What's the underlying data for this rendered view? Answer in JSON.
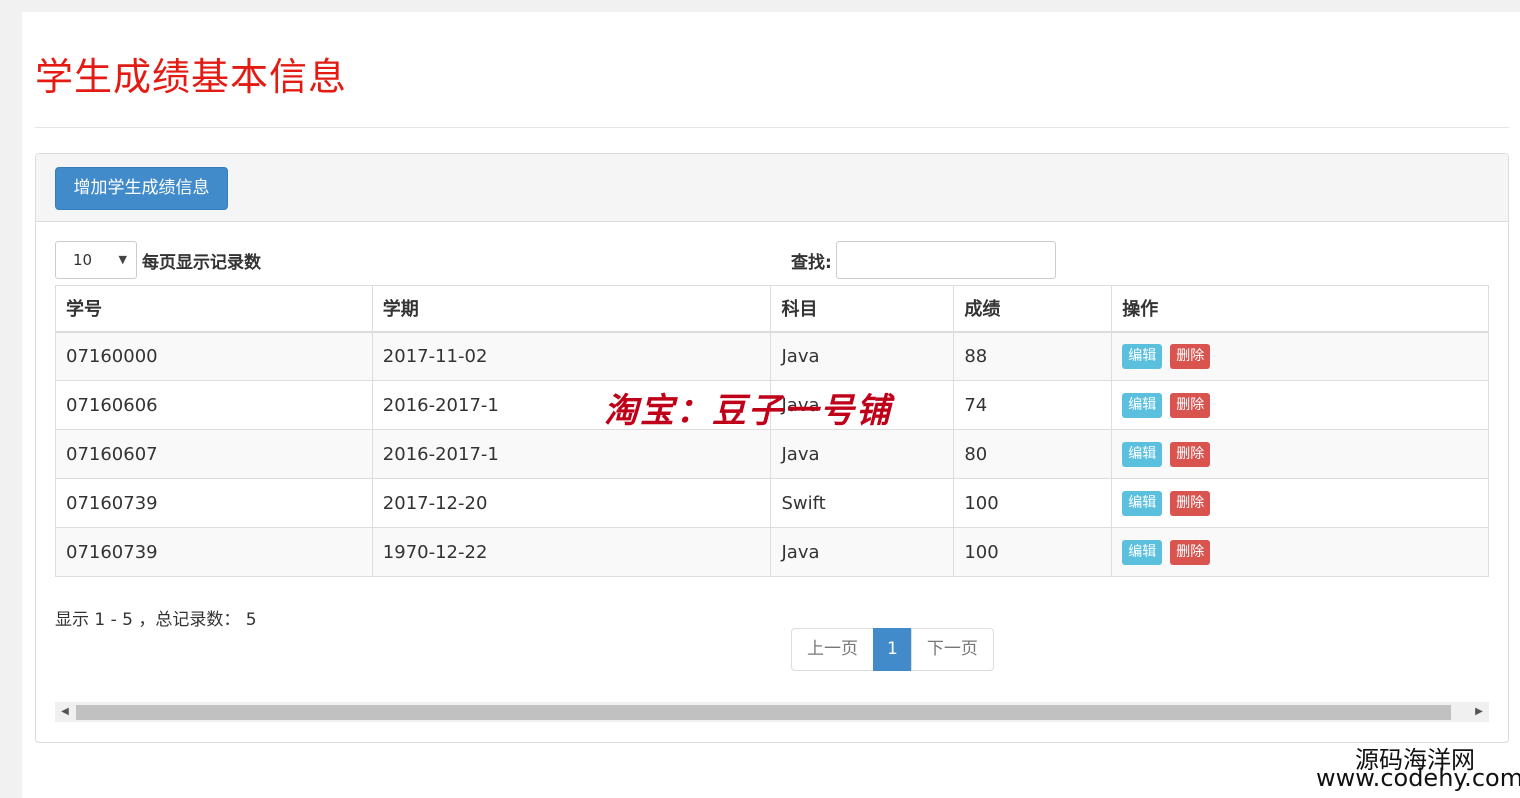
{
  "page": {
    "title": "学生成绩基本信息"
  },
  "toolbar": {
    "add_label": "增加学生成绩信息"
  },
  "length": {
    "value": "10",
    "label": "每页显示记录数"
  },
  "search": {
    "label": "查找:",
    "value": ""
  },
  "table": {
    "columns": [
      "学号",
      "学期",
      "科目",
      "成绩",
      "操作"
    ],
    "rows": [
      [
        "07160000",
        "2017-11-02",
        "Java",
        "88"
      ],
      [
        "07160606",
        "2016-2017-1",
        "Java",
        "74"
      ],
      [
        "07160607",
        "2016-2017-1",
        "Java",
        "80"
      ],
      [
        "07160739",
        "2017-12-20",
        "Swift",
        "100"
      ],
      [
        "07160739",
        "1970-12-22",
        "Java",
        "100"
      ]
    ],
    "edit_label": "编辑",
    "delete_label": "删除"
  },
  "info": "显示 1 - 5 ，总记录数： 5",
  "pagination": {
    "prev": "上一页",
    "current": "1",
    "next": "下一页"
  },
  "watermarks": {
    "center": "淘宝：豆子一号铺",
    "site_name": "源码海洋网",
    "site_url": "www.codehy.com"
  },
  "colors": {
    "title": "#e41b13",
    "primary": "#428bca",
    "edit": "#5bc0de",
    "delete": "#d9534f",
    "watermark": "#c00018"
  },
  "icons": {
    "select_caret": "caret-down-icon",
    "scroll_left": "triangle-left-icon",
    "scroll_right": "triangle-right-icon"
  }
}
